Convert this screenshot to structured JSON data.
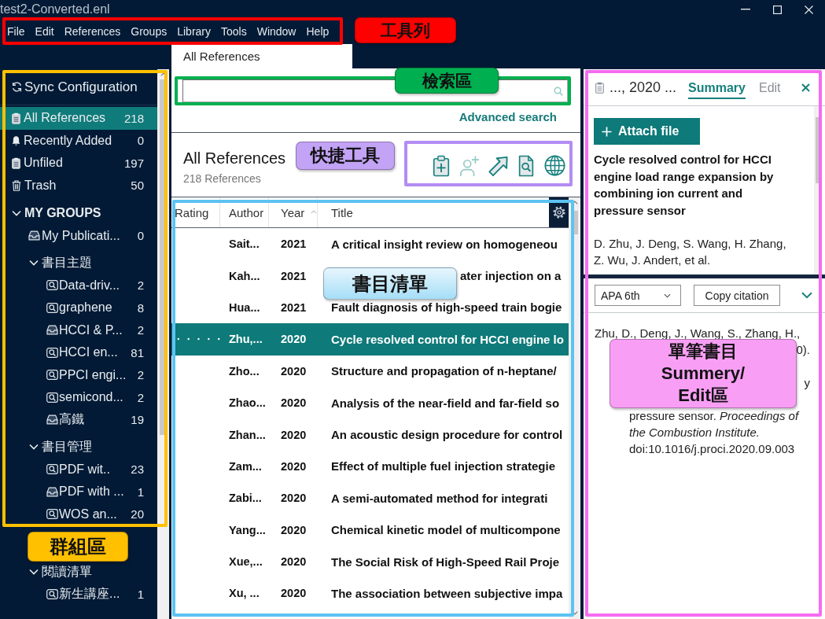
{
  "window": {
    "title": "test2-Converted.enl"
  },
  "menu": [
    "File",
    "Edit",
    "References",
    "Groups",
    "Library",
    "Tools",
    "Window",
    "Help"
  ],
  "tab": "All References",
  "sidebar": {
    "sync": "Sync Configuration",
    "library": [
      {
        "label": "All References",
        "count": "218",
        "kind": "all",
        "selected": true
      },
      {
        "label": "Recently Added",
        "count": "0",
        "kind": "recent",
        "selected": false
      },
      {
        "label": "Unfiled",
        "count": "197",
        "kind": "unfiled",
        "selected": false
      },
      {
        "label": "Trash",
        "count": "50",
        "kind": "trash",
        "selected": false
      }
    ],
    "groups": {
      "label": "MY GROUPS",
      "expanded": true,
      "children": [
        {
          "label": "My Publicati...",
          "count": "0",
          "kind": "group",
          "selected": false
        },
        {
          "label": "書目主題",
          "kind": "set",
          "expanded": true,
          "children": [
            {
              "label": "Data-driv...",
              "count": "2",
              "kind": "smart",
              "selected": false
            },
            {
              "label": "graphene",
              "count": "8",
              "kind": "smart",
              "selected": false
            },
            {
              "label": "HCCI & P...",
              "count": "2",
              "kind": "group",
              "selected": false
            },
            {
              "label": "HCCI en...",
              "count": "81",
              "kind": "smart",
              "selected": false
            },
            {
              "label": "PPCI engi...",
              "count": "2",
              "kind": "smart",
              "selected": false
            },
            {
              "label": "semicond...",
              "count": "2",
              "kind": "smart",
              "selected": false
            },
            {
              "label": "高鐵",
              "count": "19",
              "kind": "group",
              "selected": false
            }
          ]
        },
        {
          "label": "書目管理",
          "kind": "set",
          "expanded": true,
          "children": [
            {
              "label": "PDF wit..",
              "count": "23",
              "kind": "smart",
              "selected": false
            },
            {
              "label": "PDF with ...",
              "count": "1",
              "kind": "group",
              "selected": false
            },
            {
              "label": "WOS an...",
              "count": "20",
              "kind": "smart",
              "selected": false
            }
          ]
        },
        {
          "label": "閱讀清單",
          "kind": "set",
          "expanded": true,
          "children": [
            {
              "label": "新生講座...",
              "count": "1",
              "kind": "smart",
              "selected": false
            }
          ]
        }
      ]
    }
  },
  "search": {
    "advanced_link": "Advanced search"
  },
  "list_header": {
    "title": "All References",
    "subtitle": "218 References"
  },
  "tools": [
    {
      "kind": "new",
      "disabled": false
    },
    {
      "kind": "share",
      "disabled": true
    },
    {
      "kind": "export",
      "disabled": false
    },
    {
      "kind": "find",
      "disabled": false
    },
    {
      "kind": "web",
      "disabled": false
    }
  ],
  "table": {
    "columns": [
      {
        "label": "Rating",
        "sorted": false
      },
      {
        "label": "Author",
        "sorted": false
      },
      {
        "label": "Year",
        "sorted": true
      },
      {
        "label": "Title",
        "sorted": false
      }
    ],
    "rows": [
      {
        "author": "Sait...",
        "year": "2021",
        "title": "A critical insight review on homogeneou",
        "selected": false
      },
      {
        "author": "Kah...",
        "year": "2021",
        "title": "ater injection on a",
        "selected": false
      },
      {
        "author": "Hua...",
        "year": "2021",
        "title": "Fault diagnosis of high-speed train bogie",
        "selected": false
      },
      {
        "author": "Zhu,...",
        "year": "2020",
        "title": "Cycle resolved control for HCCI engine lo",
        "selected": true
      },
      {
        "author": "Zho...",
        "year": "2020",
        "title": "Structure and propagation of n-heptane/",
        "selected": false
      },
      {
        "author": "Zhao...",
        "year": "2020",
        "title": "Analysis of the near-field and far-field so",
        "selected": false
      },
      {
        "author": "Zhan...",
        "year": "2020",
        "title": "An acoustic design procedure for control",
        "selected": false
      },
      {
        "author": "Zam...",
        "year": "2020",
        "title": "Effect of multiple fuel injection strategie",
        "selected": false
      },
      {
        "author": "Zabi...",
        "year": "2020",
        "title": "A semi-automated method for integrati",
        "selected": false
      },
      {
        "author": "Yang...",
        "year": "2020",
        "title": "Chemical kinetic model of multicompone",
        "selected": false
      },
      {
        "author": "Xue,...",
        "year": "2020",
        "title": "The Social Risk of High-Speed Rail Proje",
        "selected": false
      },
      {
        "author": "Xu, ...",
        "year": "2020",
        "title": "The association between subjective impa",
        "selected": false
      }
    ]
  },
  "summary": {
    "heading": "..., 2020 ...",
    "tabs": [
      {
        "label": "Summary",
        "selected": true
      },
      {
        "label": "Edit",
        "selected": false
      }
    ],
    "attach": "Attach file",
    "title": "Cycle resolved control for HCCI engine load range expansion by combining ion current and pressure sensor",
    "authors": "D. Zhu, J. Deng, S. Wang, H. Zhang, Z. Wu, J. Andert, et al.",
    "style": "APA 6th",
    "copy": "Copy citation",
    "citation": [
      {
        "kind": "lead",
        "text": "Zhu, D., Deng, J., Wang, S., Zhang, H.,"
      },
      {
        "kind": "cut",
        "text": "0)."
      },
      {
        "kind": "cut",
        "text": "y"
      },
      {
        "kind": "body",
        "text": "pressure sensor. *Proceedings of*"
      },
      {
        "kind": "journal",
        "text": "the Combustion Institute."
      },
      {
        "kind": "body",
        "text": "doi:10.1016/j.proci.2020.09.003"
      }
    ]
  },
  "annotations": [
    {
      "label": "工具列",
      "color": "#ff0000"
    },
    {
      "label": "檢索區",
      "color": "#00b050"
    },
    {
      "label": "快捷工具",
      "color": "#b38cf3"
    },
    {
      "label": "書目清單",
      "color": "#5cc3f2"
    },
    {
      "label": "群組區",
      "color": "#ffc000"
    },
    {
      "label": "單筆書目 Summery/ Edit區",
      "color": "#f56cef"
    }
  ]
}
